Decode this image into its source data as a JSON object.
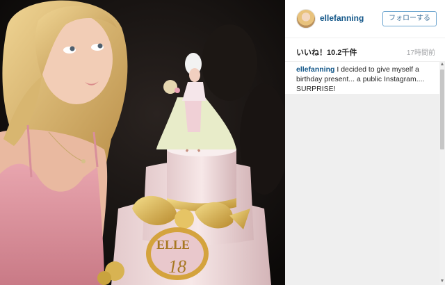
{
  "post": {
    "username": "ellefanning",
    "follow_label": "フォローする",
    "likes_text": "いいね！10.2千件",
    "time_text": "17時間前",
    "caption_author": "ellefanning",
    "caption_text": " I decided to give myself a birthday present... a public Instagram.... SURPRISE!"
  },
  "photo": {
    "cake_text": "ELLE",
    "cake_number": "18"
  },
  "colors": {
    "link_blue": "#125688",
    "follow_border": "#6ea6cf",
    "muted_gray": "#a5a7aa"
  },
  "icons": {
    "scroll_up": "▲",
    "scroll_down": "▼"
  }
}
